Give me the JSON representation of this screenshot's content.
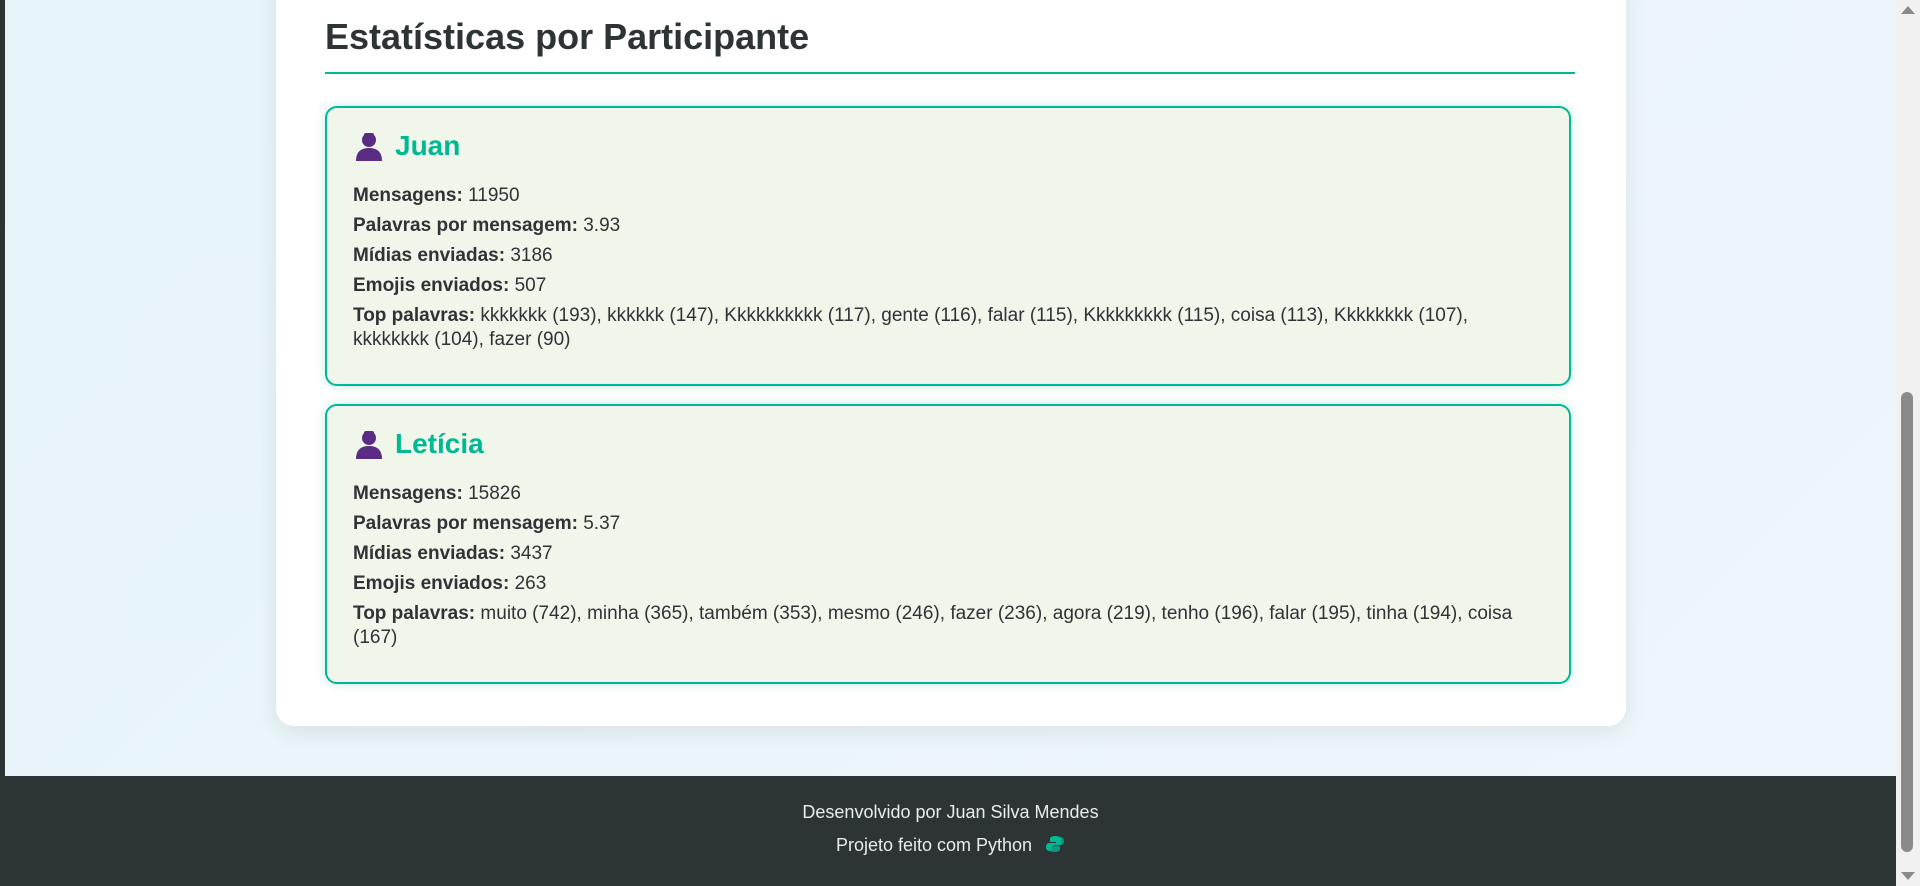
{
  "section": {
    "title": "Estatísticas por Participante"
  },
  "labels": {
    "messages": "Mensagens:",
    "words_per_message": "Palavras por mensagem:",
    "media_sent": "Mídias enviadas:",
    "emojis_sent": "Emojis enviados:",
    "top_words": "Top palavras:"
  },
  "participants": [
    {
      "name": "Juan",
      "icon": "user-icon",
      "messages": "11950",
      "words_per_message": "3.93",
      "media_sent": "3186",
      "emojis_sent": "507",
      "top_words": "kkkkkkk (193), kkkkkk (147), Kkkkkkkkkk (117), gente (116), falar (115), Kkkkkkkkk (115), coisa (113), Kkkkkkkk (107), kkkkkkkk (104), fazer (90)"
    },
    {
      "name": "Letícia",
      "icon": "user-icon",
      "messages": "15826",
      "words_per_message": "5.37",
      "media_sent": "3437",
      "emojis_sent": "263",
      "top_words": "muito (742), minha (365), também (353), mesmo (246), fazer (236), agora (219), tenho (196), falar (195), tinha (194), coisa (167)"
    }
  ],
  "footer": {
    "credit": "Desenvolvido por Juan Silva Mendes",
    "made_with": "Projeto feito com Python",
    "icon": "python-icon"
  },
  "colors": {
    "accent": "#00b894",
    "card_bg": "#f0f6e9",
    "text": "#2d3436",
    "footer_bg": "#2d3436",
    "user_icon": "#5b2c83"
  }
}
